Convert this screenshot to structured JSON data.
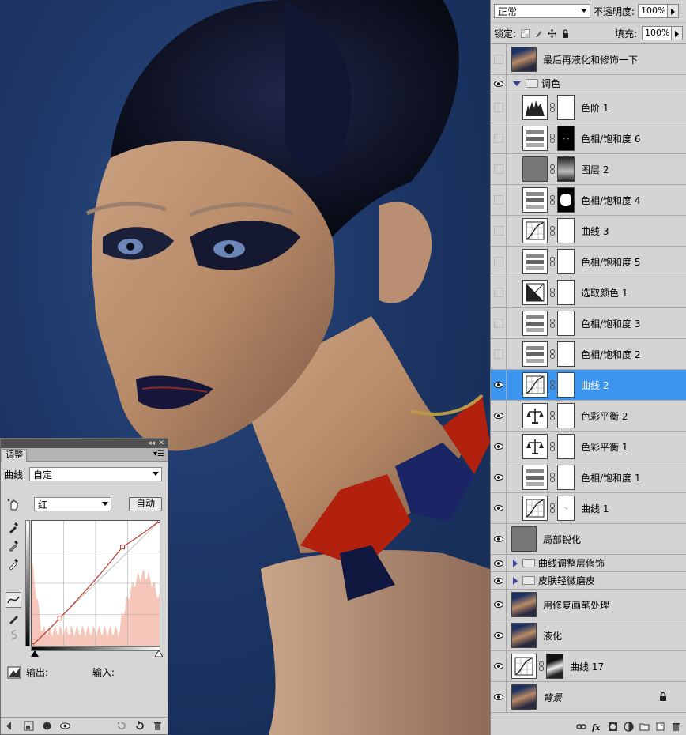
{
  "blend_mode": {
    "value": "正常"
  },
  "opacity": {
    "label": "不透明度:",
    "value": "100%"
  },
  "lock": {
    "label": "锁定:"
  },
  "fill": {
    "label": "填充:",
    "value": "100%"
  },
  "layers": [
    {
      "name": "最后再液化和修饰一下",
      "kind": "photo",
      "visible": false
    },
    {
      "name": "调色",
      "kind": "group-open",
      "visible": true
    },
    {
      "name": "色阶 1",
      "kind": "levels",
      "visible": false
    },
    {
      "name": "色相/饱和度 6",
      "kind": "hue",
      "visible": false
    },
    {
      "name": "图层 2",
      "kind": "gray",
      "visible": false
    },
    {
      "name": "色相/饱和度 4",
      "kind": "hue",
      "visible": false
    },
    {
      "name": "曲线 3",
      "kind": "curves",
      "visible": false
    },
    {
      "name": "色相/饱和度 5",
      "kind": "hue",
      "visible": false
    },
    {
      "name": "选取颜色 1",
      "kind": "selcolor",
      "visible": false
    },
    {
      "name": "色相/饱和度 3",
      "kind": "hue",
      "visible": false
    },
    {
      "name": "色相/饱和度 2",
      "kind": "hue",
      "visible": false
    },
    {
      "name": "曲线 2",
      "kind": "curves",
      "visible": true,
      "selected": true
    },
    {
      "name": "色彩平衡 2",
      "kind": "balance",
      "visible": true
    },
    {
      "name": "色彩平衡 1",
      "kind": "balance",
      "visible": true
    },
    {
      "name": "色相/饱和度 1",
      "kind": "hue",
      "visible": true
    },
    {
      "name": "曲线 1",
      "kind": "curves",
      "visible": true
    },
    {
      "name": "局部锐化",
      "kind": "grayonly",
      "visible": true
    },
    {
      "name": "曲线调整层修饰",
      "kind": "group-closed",
      "visible": true
    },
    {
      "name": "皮肤轻微磨皮",
      "kind": "group-closed",
      "visible": true
    },
    {
      "name": "用修复画笔处理",
      "kind": "photo",
      "visible": true
    },
    {
      "name": "液化",
      "kind": "photo",
      "visible": true
    },
    {
      "name": "曲线 17",
      "kind": "curves-photo",
      "visible": true
    },
    {
      "name": "背景",
      "kind": "background",
      "visible": true
    }
  ],
  "adjustments": {
    "tab": "调整",
    "preset_label": "曲线",
    "preset_value": "自定",
    "channel": "红",
    "auto_button": "自动",
    "output_label": "输出:",
    "input_label": "输入:",
    "curve_points": [
      [
        0,
        0
      ],
      [
        0.22,
        0.22
      ],
      [
        0.71,
        0.79
      ],
      [
        1,
        1
      ]
    ]
  },
  "colors": {
    "selection": "#3c96f0",
    "curve": "#c0392b",
    "histogram": "#f2b8a8"
  }
}
